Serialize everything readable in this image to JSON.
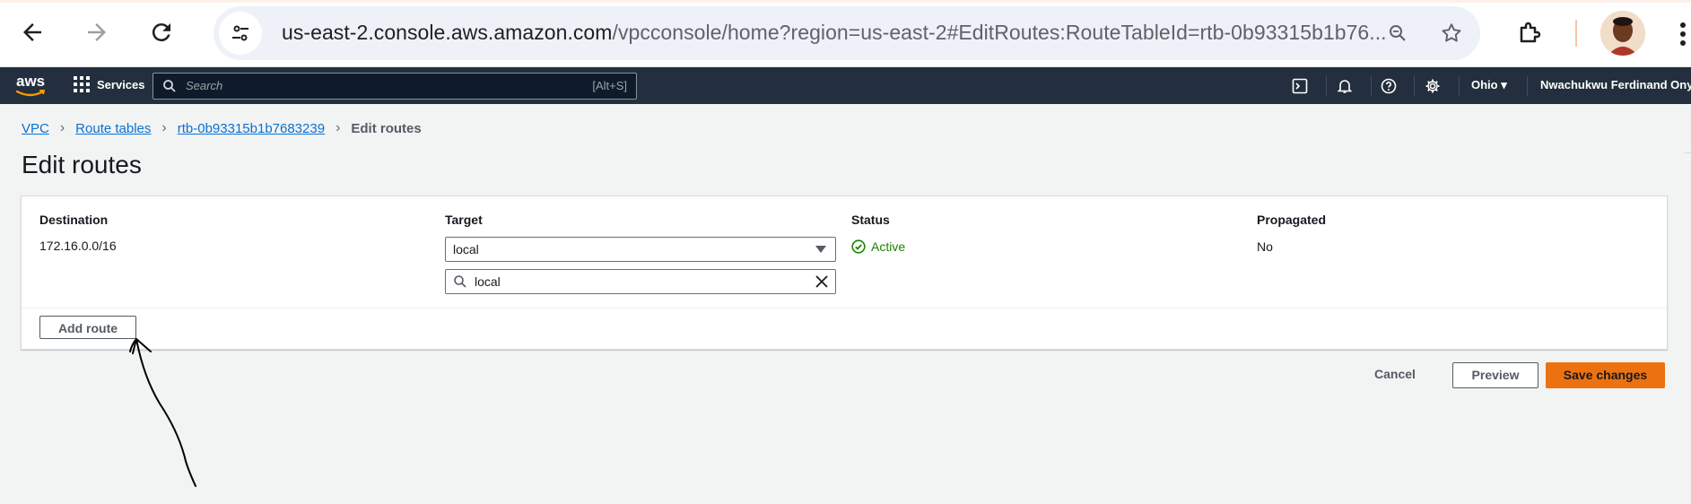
{
  "browser": {
    "url_host": "us-east-2.console.aws.amazon.com",
    "url_rest": "/vpcconsole/home?region=us-east-2#EditRoutes:RouteTableId=rtb-0b93315b1b76...",
    "icons": [
      "back-icon",
      "forward-icon",
      "reload-icon",
      "tune-icon",
      "zoom-icon",
      "star-icon",
      "extension-icon",
      "avatar",
      "menu-icon"
    ]
  },
  "awsnav": {
    "logo": "aws",
    "services": "Services",
    "search_placeholder": "Search",
    "search_shortcut": "[Alt+S]",
    "region": "Ohio ▾",
    "user": "Nwachukwu Ferdinand Onyeka"
  },
  "breadcrumb": {
    "items": [
      "VPC",
      "Route tables",
      "rtb-0b93315b1b7683239"
    ],
    "current": "Edit routes"
  },
  "page": {
    "title": "Edit routes"
  },
  "routes": {
    "columns": [
      "Destination",
      "Target",
      "Status",
      "Propagated"
    ],
    "rows": [
      {
        "destination": "172.16.0.0/16",
        "target": "local",
        "target_filter": "local",
        "status": "Active",
        "propagated": "No"
      }
    ],
    "add_label": "Add route"
  },
  "footer": {
    "cancel": "Cancel",
    "preview": "Preview",
    "save": "Save changes"
  },
  "colors": {
    "aws_nav": "#232f3e",
    "primary_button": "#ec7211",
    "link": "#0972d3",
    "status_active": "#1d8102"
  }
}
